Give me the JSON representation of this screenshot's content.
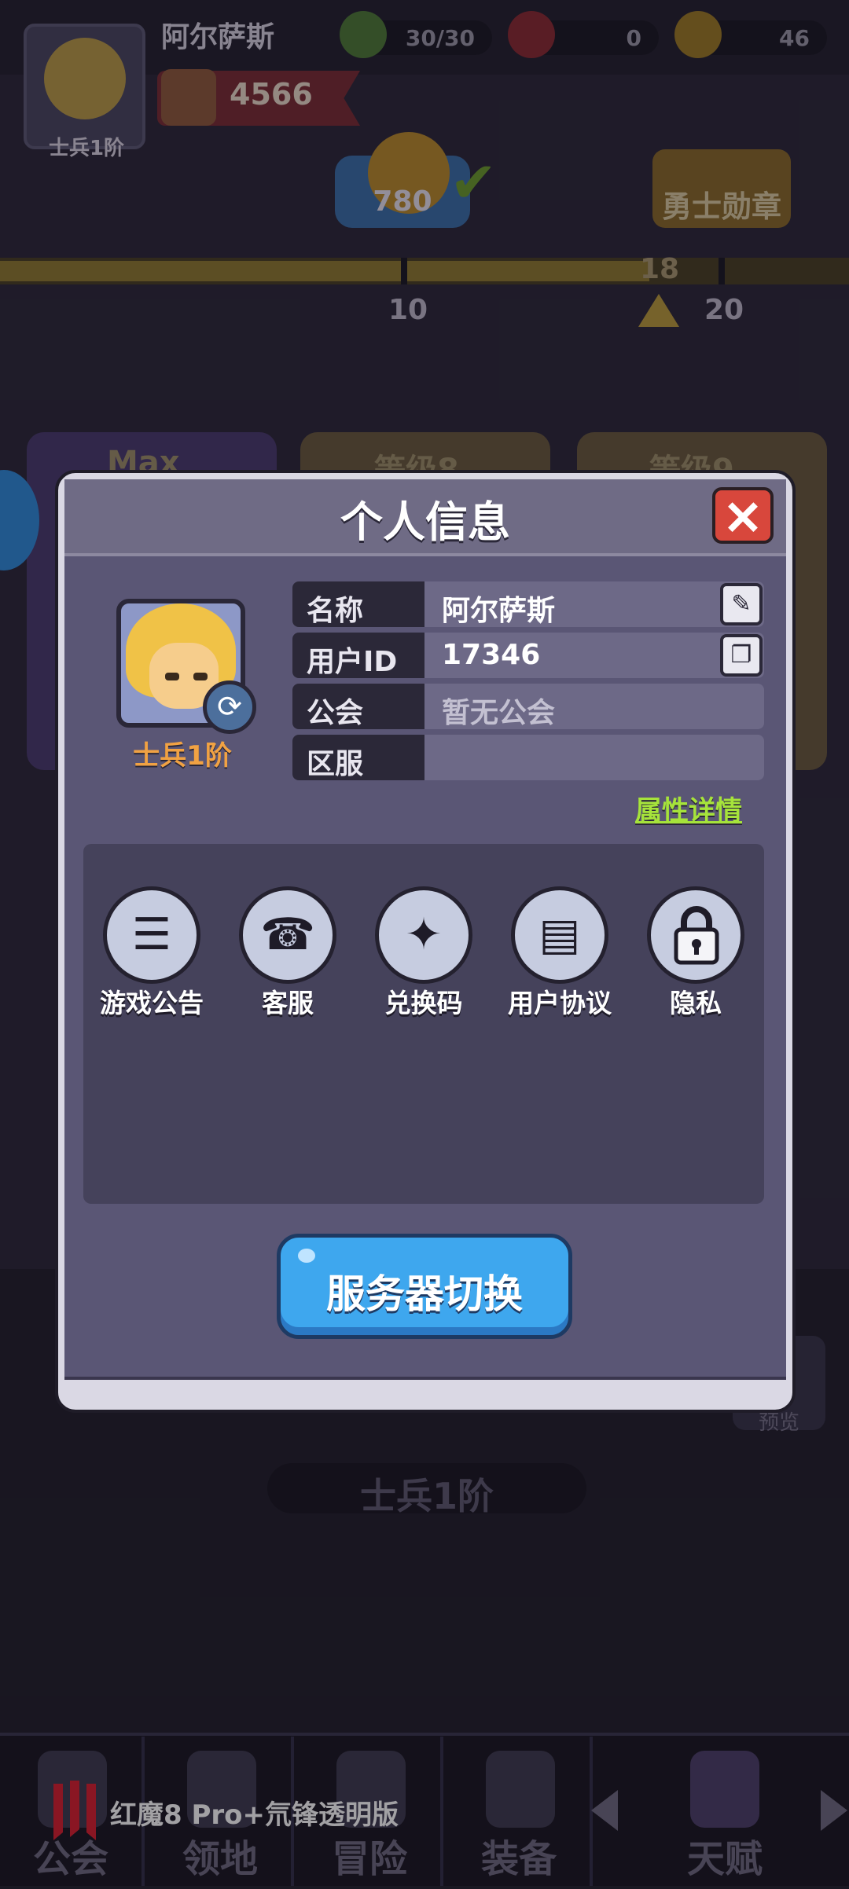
{
  "hud": {
    "player_name": "阿尔萨斯",
    "player_rank": "士兵1阶",
    "power": "4566",
    "resources": [
      {
        "icon": "energy-icon",
        "value": "30/30"
      },
      {
        "icon": "gem-icon",
        "value": "0"
      },
      {
        "icon": "gold-coin-icon",
        "value": "46"
      }
    ],
    "token_value": "780",
    "medal_label": "勇士勋章",
    "progress": {
      "value": 18,
      "ticks": [
        "10",
        "20"
      ],
      "marker_label": "18"
    },
    "cards": [
      "Max",
      "等级8",
      "等级9"
    ],
    "bottom_rank": "士兵1阶",
    "preview_label": "预览"
  },
  "nav": {
    "tabs": [
      "公会",
      "领地",
      "冒险",
      "装备",
      "天赋"
    ],
    "watermark": "红魔8 Pro+氘锋透明版"
  },
  "dialog": {
    "title": "个人信息",
    "avatar_rank": "士兵1阶",
    "rows": [
      {
        "key": "名称",
        "value": "阿尔萨斯"
      },
      {
        "key": "用户ID",
        "value": "17346"
      },
      {
        "key": "公会",
        "value": "暂无公会"
      },
      {
        "key": "区服",
        "value": ""
      }
    ],
    "attr_link": "属性详情",
    "menu": [
      {
        "icon": "announcement-icon",
        "label": "游戏公告"
      },
      {
        "icon": "customer-service-icon",
        "label": "客服"
      },
      {
        "icon": "gift-code-icon",
        "label": "兑换码"
      },
      {
        "icon": "user-agreement-icon",
        "label": "用户协议"
      },
      {
        "icon": "privacy-lock-icon",
        "label": "隐私"
      }
    ],
    "server_button": "服务器切换"
  },
  "colors": {
    "accent_blue": "#3ea7ee",
    "rank_orange": "#f1a243",
    "link_green": "#a6e33b",
    "close_red": "#d8473c"
  }
}
